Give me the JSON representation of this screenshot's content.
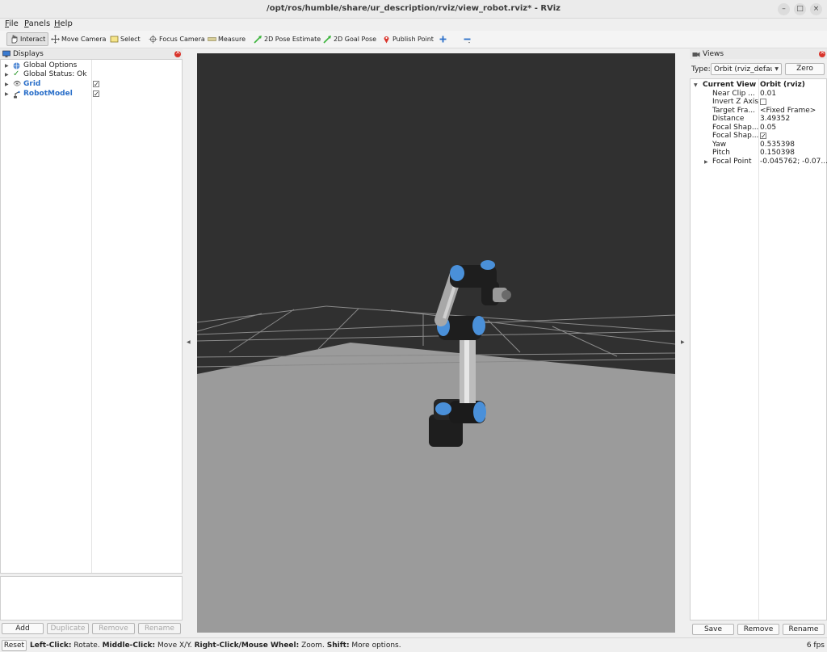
{
  "window": {
    "title": "/opt/ros/humble/share/ur_description/rviz/view_robot.rviz* - RViz",
    "min": "–",
    "max": "□",
    "close": "×"
  },
  "menu": {
    "file": "File",
    "panels": "Panels",
    "help": "Help"
  },
  "toolbar": {
    "interact": "Interact",
    "move_camera": "Move Camera",
    "select": "Select",
    "focus_camera": "Focus Camera",
    "measure": "Measure",
    "pose_estimate": "2D Pose Estimate",
    "goal_pose": "2D Goal Pose",
    "publish_point": "Publish Point"
  },
  "displays": {
    "title": "Displays",
    "items": [
      {
        "label": "Global Options"
      },
      {
        "label": "Global Status: Ok"
      },
      {
        "label": "Grid",
        "checked": "✓"
      },
      {
        "label": "RobotModel",
        "checked": "✓"
      }
    ],
    "buttons": {
      "add": "Add",
      "duplicate": "Duplicate",
      "remove": "Remove",
      "rename": "Rename"
    }
  },
  "views": {
    "title": "Views",
    "type_label": "Type:",
    "type_value": "Orbit (rviz_defau",
    "zero": "Zero",
    "current_view": {
      "label": "Current View",
      "value": "Orbit (rviz)"
    },
    "props": [
      {
        "label": "Near Clip ...",
        "value": "0.01"
      },
      {
        "label": "Invert Z Axis",
        "value": ""
      },
      {
        "label": "Target Fra...",
        "value": "<Fixed Frame>"
      },
      {
        "label": "Distance",
        "value": "3.49352"
      },
      {
        "label": "Focal Shap...",
        "value": "0.05"
      },
      {
        "label": "Focal Shap...",
        "value": "✓"
      },
      {
        "label": "Yaw",
        "value": "0.535398"
      },
      {
        "label": "Pitch",
        "value": "0.150398"
      },
      {
        "label": "Focal Point",
        "value": "-0.045762; -0.07..."
      }
    ],
    "buttons": {
      "save": "Save",
      "remove": "Remove",
      "rename": "Rename"
    }
  },
  "status": {
    "reset": "Reset",
    "k1": "Left-Click:",
    "v1": " Rotate. ",
    "k2": "Middle-Click:",
    "v2": " Move X/Y. ",
    "k3": "Right-Click/Mouse Wheel:",
    "v3": " Zoom. ",
    "k4": "Shift:",
    "v4": " More options.",
    "fps": "6 fps"
  },
  "colors": {
    "accent": "#2a6fc9",
    "viewport_bg": "#303030",
    "ground": "#9a9a9a",
    "robot_joint": "#4a90d9"
  }
}
